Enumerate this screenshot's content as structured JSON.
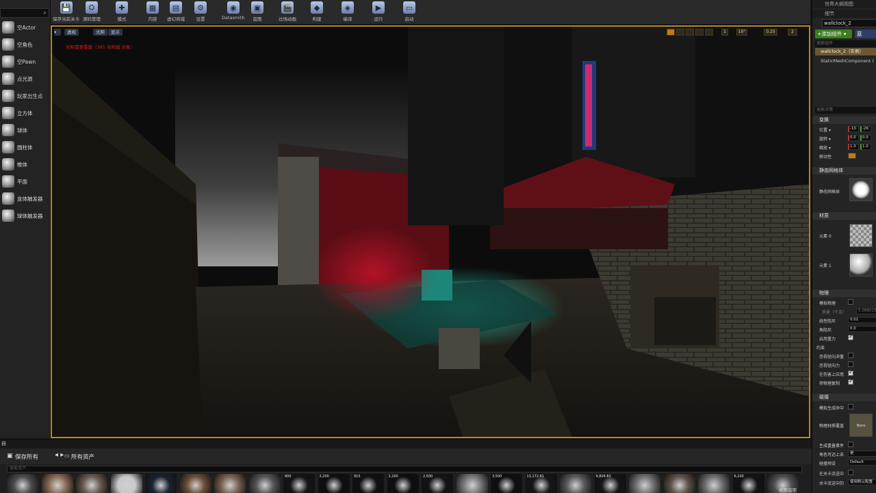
{
  "place_panel": {
    "items": [
      {
        "label": "空Actor",
        "icon": "sphere-icon"
      },
      {
        "label": "空角色",
        "icon": "empty-character-icon"
      },
      {
        "label": "空Pawn",
        "icon": "pawn-icon"
      },
      {
        "label": "点光源",
        "icon": "point-light-icon"
      },
      {
        "label": "玩家出生点",
        "icon": "player-start-icon"
      },
      {
        "label": "立方体",
        "icon": "cube-icon"
      },
      {
        "label": "球体",
        "icon": "sphere-icon"
      },
      {
        "label": "圆柱体",
        "icon": "cylinder-icon"
      },
      {
        "label": "椎体",
        "icon": "cone-icon"
      },
      {
        "label": "平面",
        "icon": "plane-icon"
      },
      {
        "label": "盒体触发器",
        "icon": "box-trigger-icon"
      },
      {
        "label": "球体触发器",
        "icon": "sphere-trigger-icon"
      }
    ]
  },
  "toolbar": {
    "buttons": [
      {
        "label": "保存当前关卡",
        "icon": "save-icon"
      },
      {
        "label": "源码管理",
        "icon": "source-control-icon"
      },
      {
        "label": "模式",
        "icon": "modes-icon"
      },
      {
        "label": "内容",
        "icon": "content-icon"
      },
      {
        "label": "虚幻商城",
        "icon": "marketplace-icon"
      },
      {
        "label": "设置",
        "icon": "settings-icon"
      },
      {
        "label": "Datasmith",
        "icon": "datasmith-icon"
      },
      {
        "label": "蓝图",
        "icon": "blueprint-icon"
      },
      {
        "label": "过场动画",
        "icon": "cinematics-icon"
      },
      {
        "label": "构建",
        "icon": "build-icon"
      },
      {
        "label": "编译",
        "icon": "compile-icon"
      },
      {
        "label": "运行",
        "icon": "play-icon"
      },
      {
        "label": "启动",
        "icon": "launch-icon"
      }
    ]
  },
  "viewport": {
    "mode_buttons": [
      "透视",
      "光照",
      "显示"
    ],
    "warning": "光照需要重建（385 未构建 对象）",
    "right_buttons": [
      "1",
      "10°",
      "0.25",
      "2"
    ]
  },
  "outliner": {
    "tab": "世界大纲视图"
  },
  "details": {
    "tab": "细节",
    "actor_name": "wallclock_2",
    "add_component": "+添加组件 ▾",
    "blueprint_button": "蓝",
    "search_components_placeholder": "搜索组件",
    "root_component": "wallclock_2（实例）",
    "mesh_component": "StaticMeshComponent (",
    "search_details_placeholder": "搜索详情",
    "transform": {
      "header": "变换",
      "location_label": "位置 ▾",
      "rotation_label": "旋转 ▾",
      "scale_label": "缩放 ▾",
      "mobility_label": "移动性",
      "location": [
        "-10",
        "-26"
      ],
      "rotation": [
        "0.0",
        "0.0"
      ],
      "scale": [
        "1.0",
        "1.0"
      ]
    },
    "static_mesh": {
      "header": "静态网格体",
      "label": "静态网格体"
    },
    "materials": {
      "header": "材质",
      "element0": "元素 0",
      "element1": "元素 1"
    },
    "physics": {
      "header": "物理",
      "simulate": "模拟物理",
      "mass_label": "质量（千克）",
      "mass_value": "5.268013",
      "linear_damping": "线性阻尼",
      "linear_damping_value": "0.01",
      "angular_damping": "角阻尼",
      "angular_damping_value": "0.0",
      "enable_gravity": "启用重力",
      "constraints": "约束",
      "ignore_radial_impulse": "忽视径向冲量",
      "ignore_radial_force": "忽视径向力",
      "apply_impulse": "在伤害上应用",
      "replicate_movement": "将物理复制"
    },
    "collision": {
      "header": "碰撞",
      "simulate_overlap": "模拟生成命中",
      "phys_material": "物理材质覆盖",
      "phys_material_value": "None",
      "generate_overlap": "生成重叠事件",
      "can_step_up": "角色可迈上去",
      "can_step_up_value": "是",
      "collision_presets": "碰撞预设",
      "collision_presets_value": "Default",
      "use_ccd": "在关卡流送中",
      "level_streaming": "关卡流送中的",
      "use_complex": "使用默认配置"
    }
  },
  "content_browser": {
    "tab": "器",
    "save_all": "保存所有",
    "nav": "◂ ▸",
    "all_assets": "所有资产",
    "search_placeholder": "搜索资产",
    "view_options": "视图选项",
    "assets": [
      "",
      "",
      "",
      "",
      "",
      "",
      "",
      "",
      "800",
      "2,200",
      "915",
      "2,200",
      "2,500",
      "",
      "3,500",
      "13,172.61",
      "",
      "9,804.82",
      "",
      "",
      "",
      "6,100",
      ""
    ]
  }
}
